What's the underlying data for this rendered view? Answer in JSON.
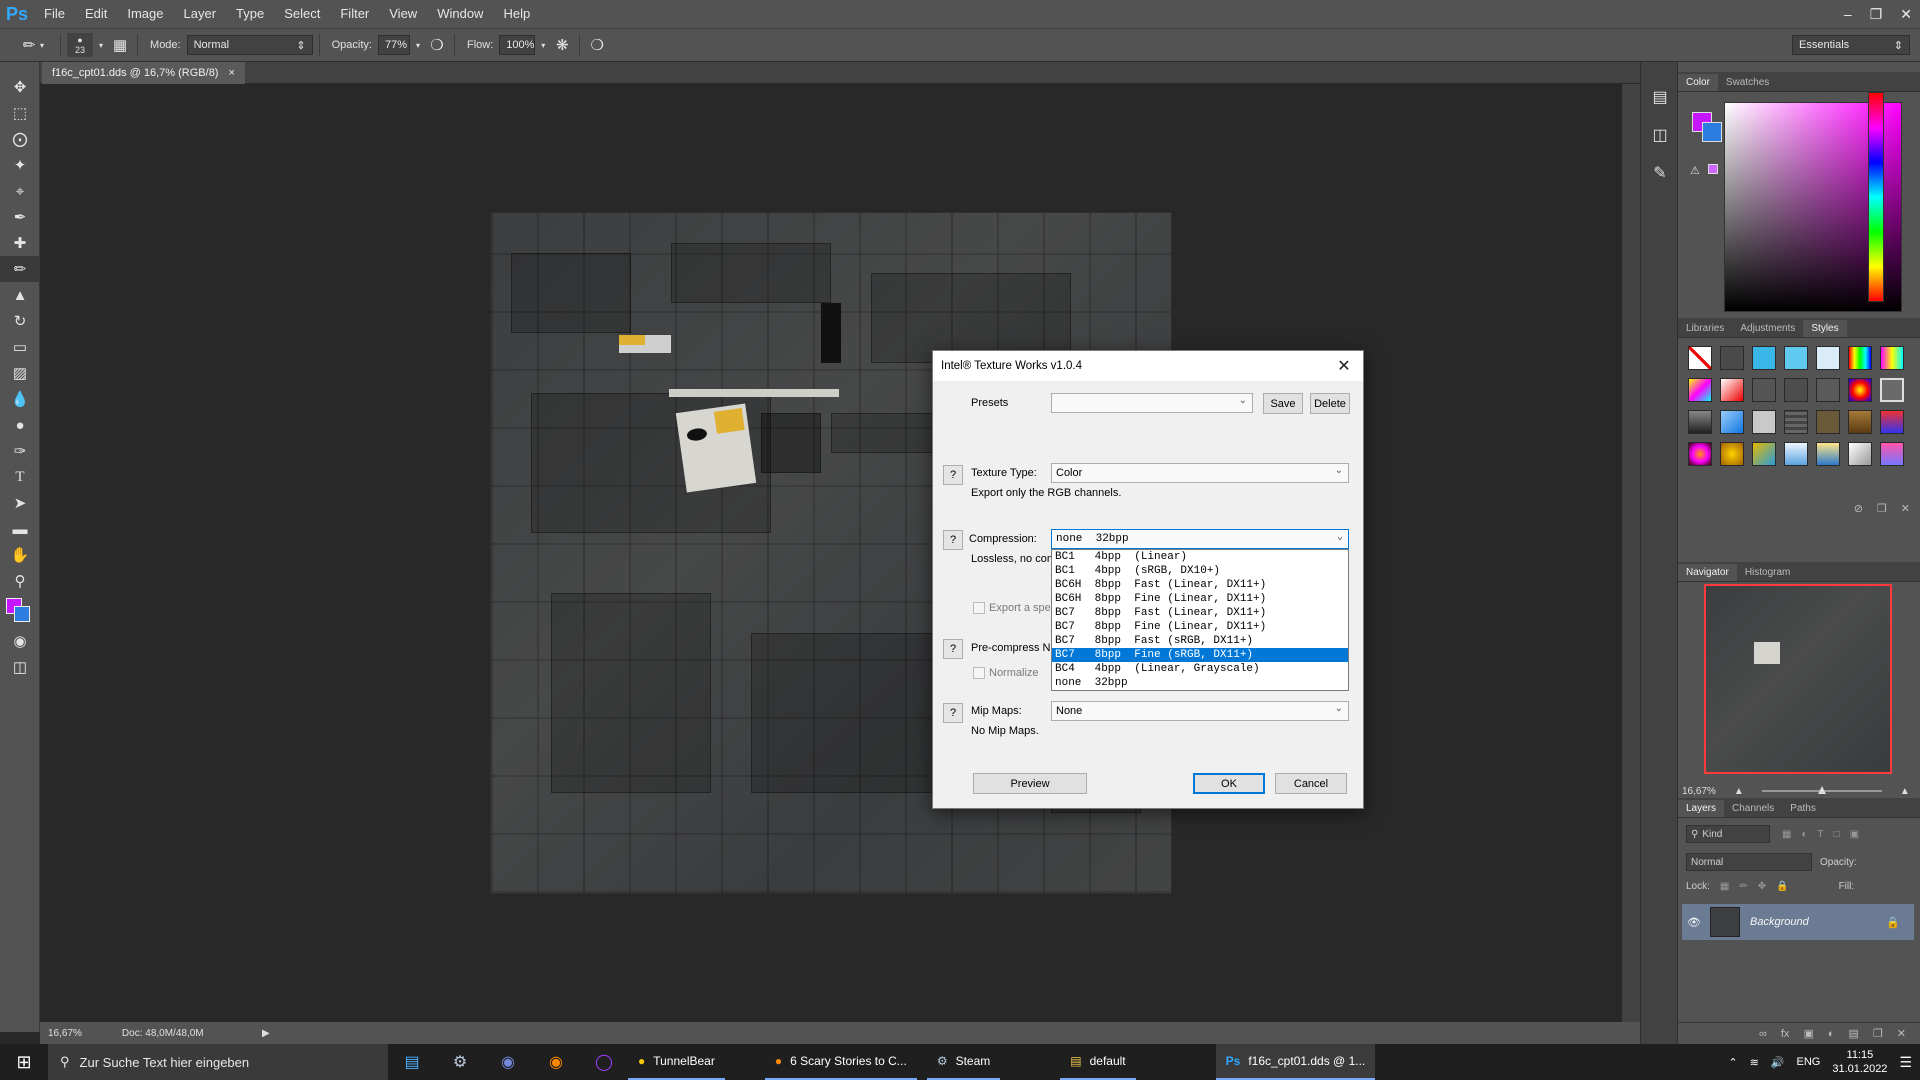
{
  "app": {
    "logo": "Ps",
    "menu": [
      "File",
      "Edit",
      "Image",
      "Layer",
      "Type",
      "Select",
      "Filter",
      "View",
      "Window",
      "Help"
    ],
    "workspace": "Essentials"
  },
  "options": {
    "brush_size": "23",
    "mode_label": "Mode:",
    "mode_value": "Normal",
    "opacity_label": "Opacity:",
    "opacity_value": "77%",
    "flow_label": "Flow:",
    "flow_value": "100%"
  },
  "document": {
    "tab_title": "f16c_cpt01.dds @ 16,7% (RGB/8)",
    "zoom": "16,67%",
    "doc_size": "Doc: 48,0M/48,0M"
  },
  "panels": {
    "color_tabs": [
      "Color",
      "Swatches"
    ],
    "style_tabs": [
      "Libraries",
      "Adjustments",
      "Styles"
    ],
    "nav_tabs": [
      "Navigator",
      "Histogram"
    ],
    "nav_zoom": "16,67%",
    "layer_tabs": [
      "Layers",
      "Channels",
      "Paths"
    ],
    "kind_label": "Kind",
    "blend_mode": "Normal",
    "opacity_label": "Opacity:",
    "lock_label": "Lock:",
    "fill_label": "Fill:",
    "layer_name": "Background"
  },
  "dialog": {
    "title": "Intel® Texture Works v1.0.4",
    "presets_label": "Presets",
    "save_label": "Save",
    "delete_label": "Delete",
    "texture_type_label": "Texture Type:",
    "texture_type_value": "Color",
    "texture_type_desc": "Export only the RGB channels.",
    "compression_label": "Compression:",
    "compression_value": "none  32bpp",
    "compression_desc": "Lossless, no com",
    "export_spec_label": "Export a spe",
    "precompress_label": "Pre-compress Nc",
    "normalize_label": "Normalize",
    "mipmaps_label": "Mip Maps:",
    "mipmaps_value": "None",
    "mipmaps_desc": "No Mip Maps.",
    "preview_label": "Preview",
    "ok_label": "OK",
    "cancel_label": "Cancel",
    "help": "?",
    "compression_options": [
      "BC1   4bpp  (Linear)",
      "BC1   4bpp  (sRGB, DX10+)",
      "BC6H  8bpp  Fast (Linear, DX11+)",
      "BC6H  8bpp  Fine (Linear, DX11+)",
      "BC7   8bpp  Fast (Linear, DX11+)",
      "BC7   8bpp  Fine (Linear, DX11+)",
      "BC7   8bpp  Fast (sRGB, DX11+)",
      "BC7   8bpp  Fine (sRGB, DX11+)",
      "BC4   4bpp  (Linear, Grayscale)",
      "none  32bpp"
    ],
    "selected_index": 7
  },
  "taskbar": {
    "search_placeholder": "Zur Suche Text hier eingeben",
    "apps": [
      "TunnelBear",
      "6 Scary Stories to C...",
      "Steam",
      "default",
      "f16c_cpt01.dds @ 1..."
    ],
    "lang": "ENG",
    "time": "11:15",
    "date": "31.01.2022"
  }
}
